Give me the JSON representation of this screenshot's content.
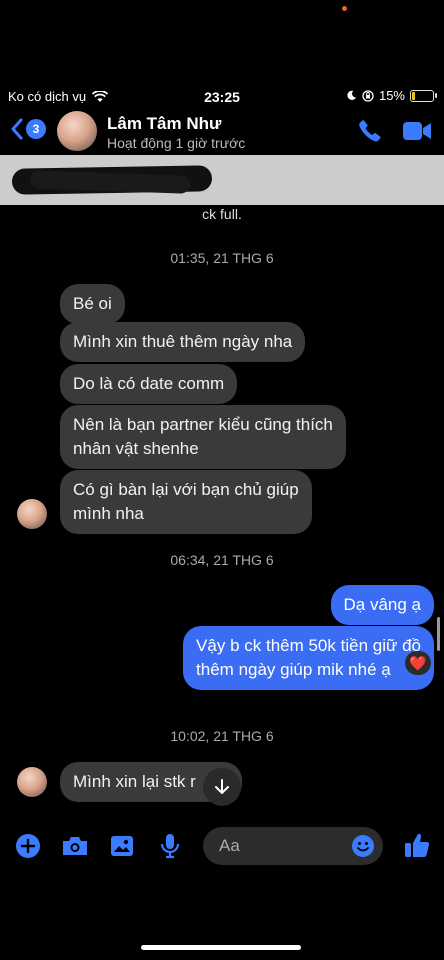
{
  "status_bar": {
    "carrier": "Ko có dịch vụ",
    "time": "23:25",
    "battery": "15%",
    "battery_level": 0.15
  },
  "header": {
    "back_badge": "3",
    "name": "Lâm Tâm Như",
    "activity": "Hoạt động 1 giờ trước"
  },
  "pinned_text": "ck full.",
  "timestamps": [
    "01:35, 21 THG 6",
    "06:34, 21 THG 6",
    "10:02, 21 THG 6"
  ],
  "messages_group1": [
    "Bé oi",
    "Mình xin thuê thêm ngày nha",
    "Do là có date comm",
    "Nên là bạn partner kiểu cũng thích\nnhân vật shenhe",
    "Có gì bàn lại với bạn chủ giúp\nmình nha"
  ],
  "messages_group2": [
    "Dạ vâng ạ",
    "Vậy b ck thêm 50k tiền giữ đồ\nthêm ngày giúp mik nhé ạ"
  ],
  "reaction": "❤️",
  "messages_group3": [
    "Mình xin lại stk r"
  ],
  "composer": {
    "placeholder": "Aa"
  },
  "colors": {
    "accent": "#3a7bff",
    "my_bubble": "#3a6cf4",
    "their_bubble": "#3a3a3c"
  }
}
